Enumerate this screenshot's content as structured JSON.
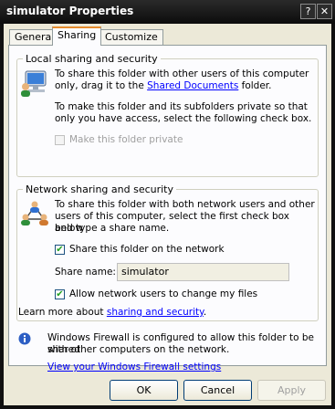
{
  "window": {
    "title": "simulator Properties",
    "help_glyph": "?",
    "close_glyph": "✕"
  },
  "tabs": [
    {
      "label": "General"
    },
    {
      "label": "Sharing"
    },
    {
      "label": "Customize"
    }
  ],
  "local": {
    "group_label": "Local sharing and security",
    "text1_a": "To share this folder with other users of this computer",
    "text1_b_pre": "only, drag it to the ",
    "text1_link": "Shared Documents",
    "text1_b_post": " folder.",
    "text2_a": "To make this folder and its subfolders private so that",
    "text2_b": "only you have access, select the following check box.",
    "private_label": "Make this folder private",
    "private_checked": false
  },
  "network": {
    "group_label": "Network sharing and security",
    "text_a": "To share this folder with both network users and other",
    "text_b": "users of this computer, select the first check box below",
    "text_c": "and type a share name.",
    "share_label": "Share this folder on the network",
    "share_checked": true,
    "share_name_label": "Share name:",
    "share_name_value": "simulator",
    "allow_label": "Allow network users to change my files",
    "allow_checked": true,
    "learn_pre": "Learn more about ",
    "learn_link": "sharing and security",
    "learn_post": "."
  },
  "firewall": {
    "text_a": "Windows Firewall is configured to allow this folder to be shared",
    "text_b": "with other computers on the network.",
    "link": "View your Windows Firewall settings"
  },
  "buttons": {
    "ok": "OK",
    "cancel": "Cancel",
    "apply": "Apply"
  },
  "check_glyph": "✔",
  "colors": {
    "accent_tab": "#e68b2c",
    "link": "#0000ff",
    "panel": "#fcfcfe",
    "dialog": "#ece9d8"
  }
}
